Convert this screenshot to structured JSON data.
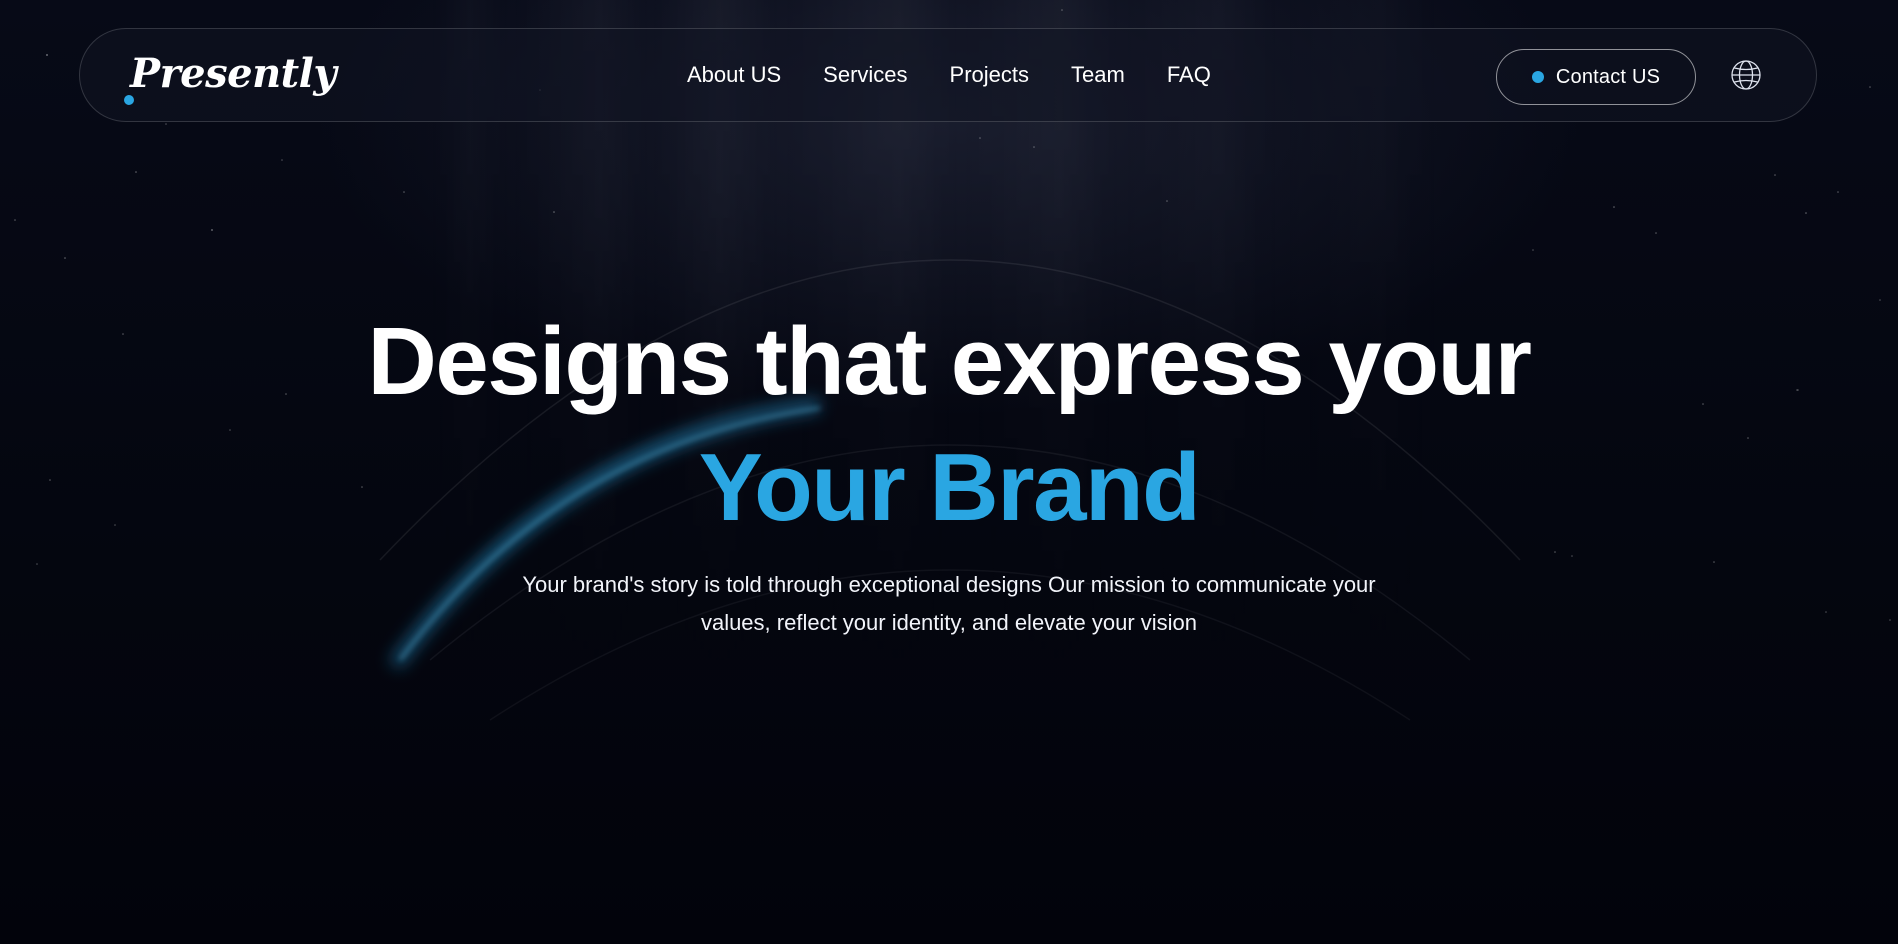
{
  "brand": {
    "logo_text": "Presently",
    "accent_color": "#2aa6e2",
    "background_color": "#03040f"
  },
  "nav": {
    "links": [
      {
        "label": "About US"
      },
      {
        "label": "Services"
      },
      {
        "label": "Projects"
      },
      {
        "label": "Team"
      },
      {
        "label": "FAQ"
      }
    ],
    "contact_label": "Contact US",
    "language_icon": "globe-icon"
  },
  "hero": {
    "title_line1": "Designs that express your",
    "title_line2": "Your Brand",
    "subtitle_line1": "Your brand's story is told through exceptional designs Our mission to communicate your",
    "subtitle_line2": "values, reflect your identity, and elevate your vision"
  }
}
